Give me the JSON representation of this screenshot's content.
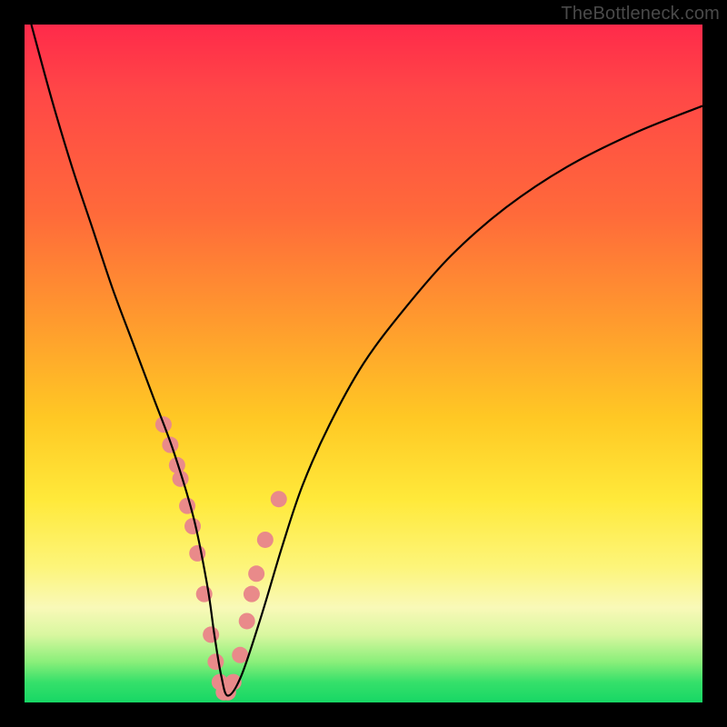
{
  "watermark": "TheBottleneck.com",
  "colors": {
    "curve": "#000000",
    "marker": "#e98a8a",
    "gradient_stops": [
      "#ff2a4a",
      "#ff4747",
      "#ff6a3a",
      "#ff9b2e",
      "#ffc824",
      "#ffe93a",
      "#fdf57a",
      "#f9f9b8",
      "#d9f7a0",
      "#8aef7a",
      "#36e06a",
      "#17d765"
    ]
  },
  "chart_data": {
    "type": "line",
    "title": "",
    "xlabel": "",
    "ylabel": "",
    "xlim": [
      0,
      100
    ],
    "ylim": [
      0,
      100
    ],
    "series": [
      {
        "name": "bottleneck-curve",
        "x": [
          1,
          4,
          7,
          10,
          13,
          16,
          19,
          22,
          25,
          27,
          28,
          29,
          30,
          32,
          35,
          38,
          41,
          45,
          50,
          56,
          63,
          71,
          80,
          90,
          100
        ],
        "values": [
          100,
          89,
          79,
          70,
          61,
          53,
          45,
          37,
          27,
          17,
          10,
          4,
          1,
          4,
          13,
          23,
          32,
          41,
          50,
          58,
          66,
          73,
          79,
          84,
          88
        ]
      }
    ],
    "markers": {
      "name": "highlighted-points",
      "x": [
        20.5,
        21.5,
        22.5,
        23.0,
        24.0,
        24.8,
        25.5,
        26.5,
        27.5,
        28.2,
        28.8,
        29.4,
        30.0,
        30.8,
        31.8,
        32.8,
        33.5,
        34.2,
        35.5,
        37.5
      ],
      "values": [
        41,
        38,
        35,
        33,
        29,
        26,
        22,
        16,
        10,
        6,
        3,
        1.5,
        1.5,
        3,
        7,
        12,
        16,
        19,
        24,
        30
      ]
    },
    "marker_radius_px": 9
  }
}
